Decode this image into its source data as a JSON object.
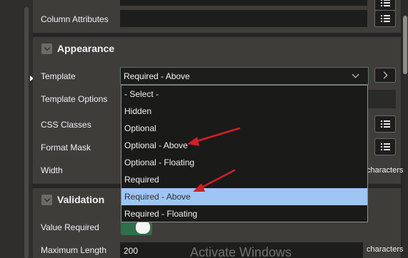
{
  "top_section": {
    "column_attributes_label": "Column Attributes"
  },
  "appearance": {
    "title": "Appearance",
    "template_label": "Template",
    "template_value": "Required - Above",
    "template_options_label": "Template Options",
    "css_classes_label": "CSS Classes",
    "format_mask_label": "Format Mask",
    "width_label": "Width",
    "width_unit": "characters"
  },
  "template_dropdown": {
    "options": [
      "- Select -",
      "Hidden",
      "Optional",
      "Optional - Above",
      "Optional - Floating",
      "Required",
      "Required - Above",
      "Required - Floating"
    ],
    "selected": "Required - Above"
  },
  "validation": {
    "title": "Validation",
    "value_required_label": "Value Required",
    "value_required_on": true,
    "max_length_label": "Maximum Length",
    "max_length_value": "200",
    "max_length_unit": "characters"
  },
  "watermark": "Activate Windows",
  "colors": {
    "panel_bg": "#3e3d3a",
    "field_bg": "#1d1d1c",
    "selected_option_bg": "#9ec5f4",
    "toggle_on": "#2f6f4a",
    "annotation_arrow": "#d21f26"
  },
  "icons": {
    "section_toggle": "chevron-down-icon",
    "list_button": "list-icon",
    "next_button": "chevron-right-icon",
    "select_caret": "chevron-down-icon"
  }
}
